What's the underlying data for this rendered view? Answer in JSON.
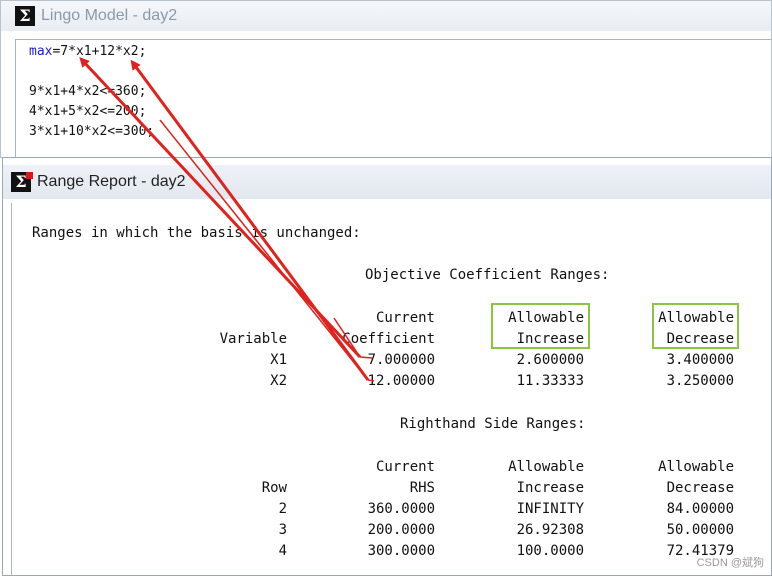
{
  "model_window": {
    "title": "Lingo Model - day2",
    "code": {
      "line1_kw": "max",
      "line1_rest": "=7*x1+12*x2;",
      "line3": "9*x1+4*x2<=360;",
      "line4": "4*x1+5*x2<=200;",
      "line5": "3*x1+10*x2<=300;"
    }
  },
  "range_window": {
    "title": "Range Report - day2",
    "intro": "Ranges in which the basis is unchanged:",
    "objective": {
      "heading": "Objective Coefficient Ranges:",
      "headers": {
        "current_top": "Current",
        "allow_inc_top": "Allowable",
        "allow_dec_top": "Allowable",
        "variable": "Variable",
        "coefficient": "Coefficient",
        "increase": "Increase",
        "decrease": "Decrease"
      },
      "rows": [
        {
          "name": "X1",
          "current": "7.000000",
          "increase": "2.600000",
          "decrease": "3.400000"
        },
        {
          "name": "X2",
          "current": "12.00000",
          "increase": "11.33333",
          "decrease": "3.250000"
        }
      ]
    },
    "rhs": {
      "heading": "Righthand Side Ranges:",
      "headers": {
        "current_top": "Current",
        "allow_inc_top": "Allowable",
        "allow_dec_top": "Allowable",
        "row": "Row",
        "rhs": "RHS",
        "increase": "Increase",
        "decrease": "Decrease"
      },
      "rows": [
        {
          "name": "2",
          "current": "360.0000",
          "increase": "INFINITY",
          "decrease": "84.00000"
        },
        {
          "name": "3",
          "current": "200.0000",
          "increase": "26.92308",
          "decrease": "50.00000"
        },
        {
          "name": "4",
          "current": "300.0000",
          "increase": "100.0000",
          "decrease": "72.41379"
        }
      ]
    }
  },
  "watermark": "CSDN @斌狗",
  "colors": {
    "highlight": "#8cc63f",
    "arrow": "#e0221d",
    "keyword": "#1a1ad6"
  }
}
